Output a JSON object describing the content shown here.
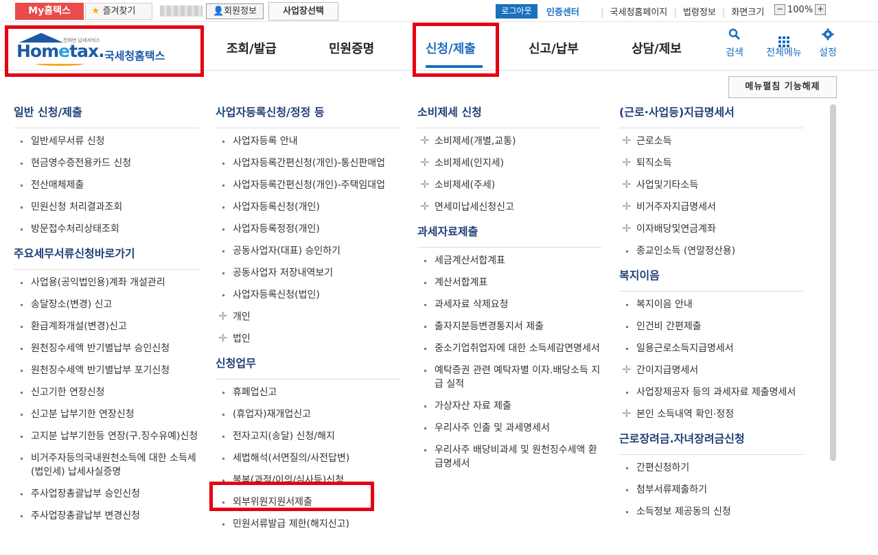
{
  "topbar": {
    "my_hometax": "My홈택스",
    "favorites": "즐겨찾기",
    "member_info": "회원정보",
    "business_select": "사업장선택",
    "logout": "로그아웃",
    "cert_center": "인증센터",
    "links": [
      "국세청홈페이지",
      "법령정보",
      "화면크기"
    ],
    "zoom_minus": "−",
    "zoom_value": "100%",
    "zoom_plus": "+"
  },
  "logo": {
    "tagline": "전화번 납세서비스",
    "brand": "Hometax",
    "brand_prefix": "Hom",
    "brand_e": "e",
    "brand_suffix": "tax.",
    "korean": "국세청홈택스"
  },
  "gnb": {
    "items": [
      "조회/발급",
      "민원증명",
      "신청/제출",
      "신고/납부",
      "상담/제보"
    ],
    "active": "신청/제출",
    "search": "검색",
    "all_menu": "전체메뉴",
    "settings": "설정"
  },
  "fold_button": "메뉴펼침 기능해제",
  "columns": [
    {
      "sections": [
        {
          "title": "일반 신청/제출",
          "items": [
            {
              "label": "일반세무서류 신청",
              "bullet": "dot"
            },
            {
              "label": "현금영수증전용카드 신청",
              "bullet": "dot"
            },
            {
              "label": "전산매체제출",
              "bullet": "dot"
            },
            {
              "label": "민원신청 처리결과조회",
              "bullet": "dot"
            },
            {
              "label": "방문접수처리상태조회",
              "bullet": "dot"
            }
          ]
        },
        {
          "title": "주요세무서류신청바로가기",
          "items": [
            {
              "label": "사업용(공익법인용)계좌 개설관리",
              "bullet": "dot"
            },
            {
              "label": "송달장소(변경) 신고",
              "bullet": "dot"
            },
            {
              "label": "환급계좌개설(변경)신고",
              "bullet": "dot"
            },
            {
              "label": "원천징수세액 반기별납부 승인신청",
              "bullet": "dot"
            },
            {
              "label": "원천징수세액 반기별납부 포기신청",
              "bullet": "dot"
            },
            {
              "label": "신고기한 연장신청",
              "bullet": "dot"
            },
            {
              "label": "신고분 납부기한 연장신청",
              "bullet": "dot"
            },
            {
              "label": "고지분 납부기한등 연장(구.징수유예)신청",
              "bullet": "dot"
            },
            {
              "label": "비거주자등의국내원천소득에 대한 소득세(법인세) 납세사실증명",
              "bullet": "dot"
            },
            {
              "label": "주사업장총괄납부 승인신청",
              "bullet": "dot"
            },
            {
              "label": "주사업장총괄납부 변경신청",
              "bullet": "dot"
            }
          ]
        }
      ]
    },
    {
      "sections": [
        {
          "title": "사업자등록신청/정정 등",
          "items": [
            {
              "label": "사업자등록 안내",
              "bullet": "dot"
            },
            {
              "label": "사업자등록간편신청(개인)-통신판매업",
              "bullet": "dot"
            },
            {
              "label": "사업자등록간편신청(개인)-주택임대업",
              "bullet": "dot"
            },
            {
              "label": "사업자등록신청(개인)",
              "bullet": "dot"
            },
            {
              "label": "사업자등록정정(개인)",
              "bullet": "dot"
            },
            {
              "label": "공동사업자(대표) 승인하기",
              "bullet": "dot"
            },
            {
              "label": "공동사업자 저장내역보기",
              "bullet": "dot"
            },
            {
              "label": "사업자등록신청(법인)",
              "bullet": "dot"
            },
            {
              "label": "개인",
              "bullet": "plus"
            },
            {
              "label": "법인",
              "bullet": "plus"
            }
          ]
        },
        {
          "title": "신청업무",
          "items": [
            {
              "label": "휴폐업신고",
              "bullet": "dot"
            },
            {
              "label": "(휴업자)재개업신고",
              "bullet": "dot"
            },
            {
              "label": "전자고지(송달) 신청/해지",
              "bullet": "dot"
            },
            {
              "label": "세법해석(서면질의/사전답변)",
              "bullet": "dot"
            },
            {
              "label": "불복(과적/이의/심사등)신청",
              "bullet": "dot"
            },
            {
              "label": "외부위원지원서제출",
              "bullet": "dot"
            },
            {
              "label": "민원서류발급 제한(해지신고)",
              "bullet": "dot"
            }
          ]
        }
      ]
    },
    {
      "sections": [
        {
          "title": "소비제세 신청",
          "items": [
            {
              "label": "소비제세(개별,교통)",
              "bullet": "plus"
            },
            {
              "label": "소비제세(인지세)",
              "bullet": "plus"
            },
            {
              "label": "소비제세(주세)",
              "bullet": "plus"
            },
            {
              "label": "면세미납세신청신고",
              "bullet": "plus"
            }
          ]
        },
        {
          "title": "과세자료제출",
          "items": [
            {
              "label": "세금계산서합계표",
              "bullet": "dot"
            },
            {
              "label": "계산서합계표",
              "bullet": "dot"
            },
            {
              "label": "과세자료 삭제요청",
              "bullet": "dot"
            },
            {
              "label": "출자지분등변경통지서 제출",
              "bullet": "dot"
            },
            {
              "label": "중소기업취업자에 대한 소득세감면명세서",
              "bullet": "dot"
            },
            {
              "label": "예탁증권 관련 예탁자별 이자.배당소득 지급 실적",
              "bullet": "dot"
            },
            {
              "label": "가상자산 자료 제출",
              "bullet": "dot"
            },
            {
              "label": "우리사주 인출 및 과세명세서",
              "bullet": "dot"
            },
            {
              "label": "우리사주 배당비과세 및 원천징수세액 환급명세서",
              "bullet": "dot"
            }
          ]
        }
      ]
    },
    {
      "sections": [
        {
          "title": "(근로·사업등)지급명세서",
          "items": [
            {
              "label": "근로소득",
              "bullet": "plus"
            },
            {
              "label": "퇴직소득",
              "bullet": "plus"
            },
            {
              "label": "사업및기타소득",
              "bullet": "plus"
            },
            {
              "label": "비거주자지급명세서",
              "bullet": "plus"
            },
            {
              "label": "이자배당및연금계좌",
              "bullet": "plus"
            },
            {
              "label": "종교인소득 (연말정산용)",
              "bullet": "dot"
            }
          ]
        },
        {
          "title": "복지이음",
          "items": [
            {
              "label": "복지이음 안내",
              "bullet": "dot"
            },
            {
              "label": "인건비 간편제출",
              "bullet": "dot"
            },
            {
              "label": "일용근로소득지급명세서",
              "bullet": "dot"
            },
            {
              "label": "간이지급명세서",
              "bullet": "plus"
            },
            {
              "label": "사업장제공자 등의 과세자료 제출명세서",
              "bullet": "dot"
            },
            {
              "label": "본인 소득내역 확인·정정",
              "bullet": "plus"
            }
          ]
        },
        {
          "title": "근로장려금.자녀장려금신청",
          "items": [
            {
              "label": "간편신청하기",
              "bullet": "dot"
            },
            {
              "label": "첨부서류제출하기",
              "bullet": "dot"
            },
            {
              "label": "소득정보 제공동의 신청",
              "bullet": "dot"
            }
          ]
        }
      ]
    }
  ],
  "colors": {
    "brand_red": "#ea4b4b",
    "brand_blue": "#1a6fbf",
    "section_title": "#1f3f75",
    "highlight_box": "#e60012"
  }
}
